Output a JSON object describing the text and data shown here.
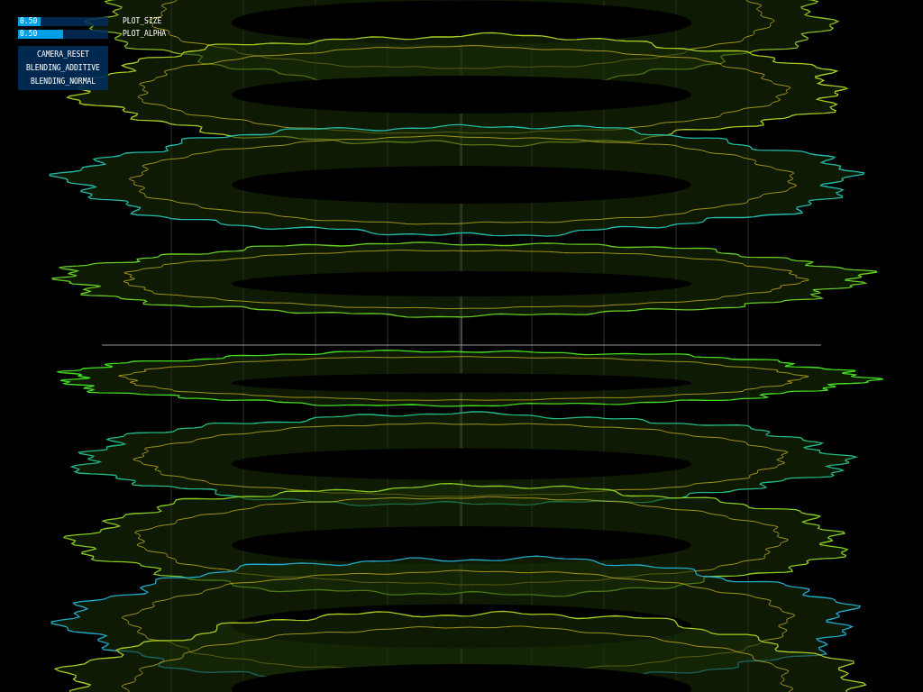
{
  "sliders": [
    {
      "value": "0.50",
      "label": "PLOT_SIZE",
      "level": 0.25
    },
    {
      "value": "0.50",
      "label": "PLOT_ALPHA",
      "level": 0.5
    }
  ],
  "buttons": [
    "CAMERA_RESET",
    "BLENDING_ADDITIVE",
    "BLENDING_NORMAL"
  ]
}
